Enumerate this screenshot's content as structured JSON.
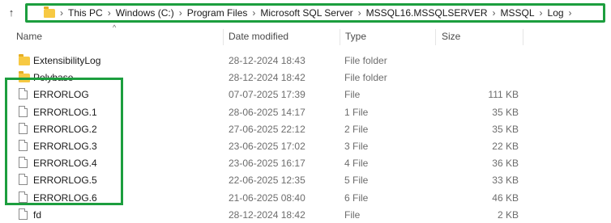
{
  "address_bar": {
    "up_glyph": "↑",
    "crumbs": [
      "This PC",
      "Windows (C:)",
      "Program Files",
      "Microsoft SQL Server",
      "MSSQL16.MSSQLSERVER",
      "MSSQL",
      "Log"
    ]
  },
  "columns": {
    "name": "Name",
    "date": "Date modified",
    "type": "Type",
    "size": "Size"
  },
  "rows": [
    {
      "name": "ExtensibilityLog",
      "date": "28-12-2024 18:43",
      "type": "File folder",
      "size": "",
      "icon": "folder-icon"
    },
    {
      "name": "Polybase",
      "date": "28-12-2024 18:42",
      "type": "File folder",
      "size": "",
      "icon": "folder-icon"
    },
    {
      "name": "ERRORLOG",
      "date": "07-07-2025 17:39",
      "type": "File",
      "size": "111 KB",
      "icon": "file-icon"
    },
    {
      "name": "ERRORLOG.1",
      "date": "28-06-2025 14:17",
      "type": "1 File",
      "size": "35 KB",
      "icon": "file-icon"
    },
    {
      "name": "ERRORLOG.2",
      "date": "27-06-2025 22:12",
      "type": "2 File",
      "size": "35 KB",
      "icon": "file-icon"
    },
    {
      "name": "ERRORLOG.3",
      "date": "23-06-2025 17:02",
      "type": "3 File",
      "size": "22 KB",
      "icon": "file-icon"
    },
    {
      "name": "ERRORLOG.4",
      "date": "23-06-2025 16:17",
      "type": "4 File",
      "size": "36 KB",
      "icon": "file-icon"
    },
    {
      "name": "ERRORLOG.5",
      "date": "22-06-2025 12:35",
      "type": "5 File",
      "size": "33 KB",
      "icon": "file-icon"
    },
    {
      "name": "ERRORLOG.6",
      "date": "21-06-2025 08:40",
      "type": "6 File",
      "size": "46 KB",
      "icon": "file-icon"
    },
    {
      "name": "fd",
      "date": "28-12-2024 18:42",
      "type": "File",
      "size": "2 KB",
      "icon": "file-icon"
    }
  ],
  "colors": {
    "highlight": "#1c9e3e",
    "folder": "#f7c943"
  }
}
